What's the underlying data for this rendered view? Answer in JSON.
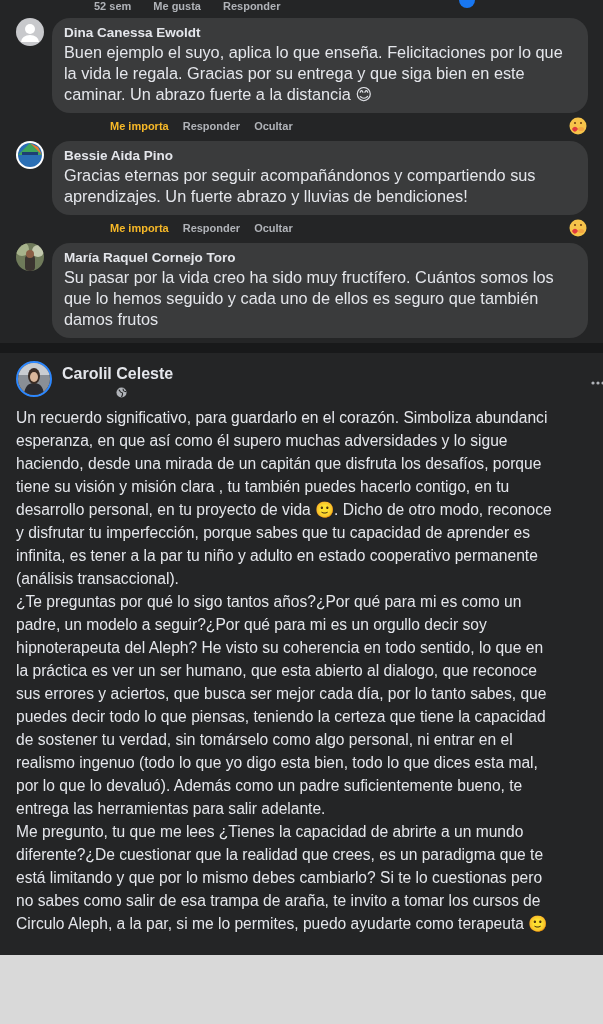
{
  "top_actions": {
    "time": "52 sem",
    "like": "Me gusta",
    "reply": "Responder"
  },
  "comments": [
    {
      "author": "Dina Canessa Ewoldt",
      "avatar": {
        "kind": "placeholder"
      },
      "text": "Buen ejemplo el suyo, aplica lo que enseña. Felicitaciones por lo que la vida le regala. Gracias por su entrega y que siga bien en este caminar. Un abrazo fuerte a la distancia 😊",
      "actions": {
        "react": "Me importa",
        "reacted": true,
        "reply": "Responder",
        "hide": "Ocultar"
      }
    },
    {
      "author": "Bessie Aida Pino",
      "avatar": {
        "kind": "logo"
      },
      "text": "Gracias eternas por seguir acompañándonos y compartiendo sus aprendizajes. Un fuerte abrazo y lluvias de bendiciones!",
      "actions": {
        "react": "Me importa",
        "reacted": true,
        "reply": "Responder",
        "hide": "Ocultar"
      }
    },
    {
      "author": "María Raquel Cornejo Toro",
      "text": "Su pasar por la vida creo ha sido muy fructífero. Cuántos somos los que lo hemos seguido y cada uno de ellos es seguro que también damos frutos"
    }
  ],
  "post": {
    "author": "Carolil Celeste",
    "paragraphs": [
      "Un recuerdo significativo, para guardarlo en el corazón. Simboliza abundanci\nesperanza, en que así como él supero muchas adversidades y lo sigue\nhaciendo, desde una mirada de un capitán que disfruta los desafíos, porque\ntiene su visión y misión clara , tu también puedes hacerlo contigo, en tu\ndesarrollo personal, en tu proyecto de vida 🙂. Dicho de otro modo, reconoce\ny disfrutar tu imperfección, porque sabes que tu capacidad de aprender es\ninfinita, es tener a la par tu niño y adulto en estado cooperativo permanente\n(análisis transaccional).",
      "¿Te preguntas por qué lo sigo tantos años?¿Por qué para mi es como un\npadre, un modelo a seguir?¿Por qué para mi es un orgullo decir soy\nhipnoterapeuta del Aleph? He visto su coherencia en todo sentido, lo que en\nla práctica es ver un ser humano, que esta abierto al dialogo, que reconoce\nsus errores y aciertos, que busca ser mejor cada día, por lo tanto sabes, que\npuedes decir todo lo que piensas, teniendo la certeza que tiene la capacidad\nde sostener tu verdad, sin tomárselo como algo personal, ni entrar en el\nrealismo ingenuo (todo lo que yo digo esta bien, todo lo que dices esta mal,\npor lo que lo devaluó). Además como un padre suficientemente bueno, te\nentrega las herramientas para salir adelante.",
      "Me pregunto, tu que me lees ¿Tienes la capacidad de abrirte a un mundo\ndiferente?¿De cuestionar que la realidad que crees, es un paradigma que te\nestá limitando y que por lo mismo debes cambiarlo? Si te lo cuestionas pero\nno sabes como salir de esa trampa de araña, te invito a tomar los cursos de\nCirculo Aleph, a la par, si me lo permites, puedo ayudarte como terapeuta 🙂"
    ]
  }
}
